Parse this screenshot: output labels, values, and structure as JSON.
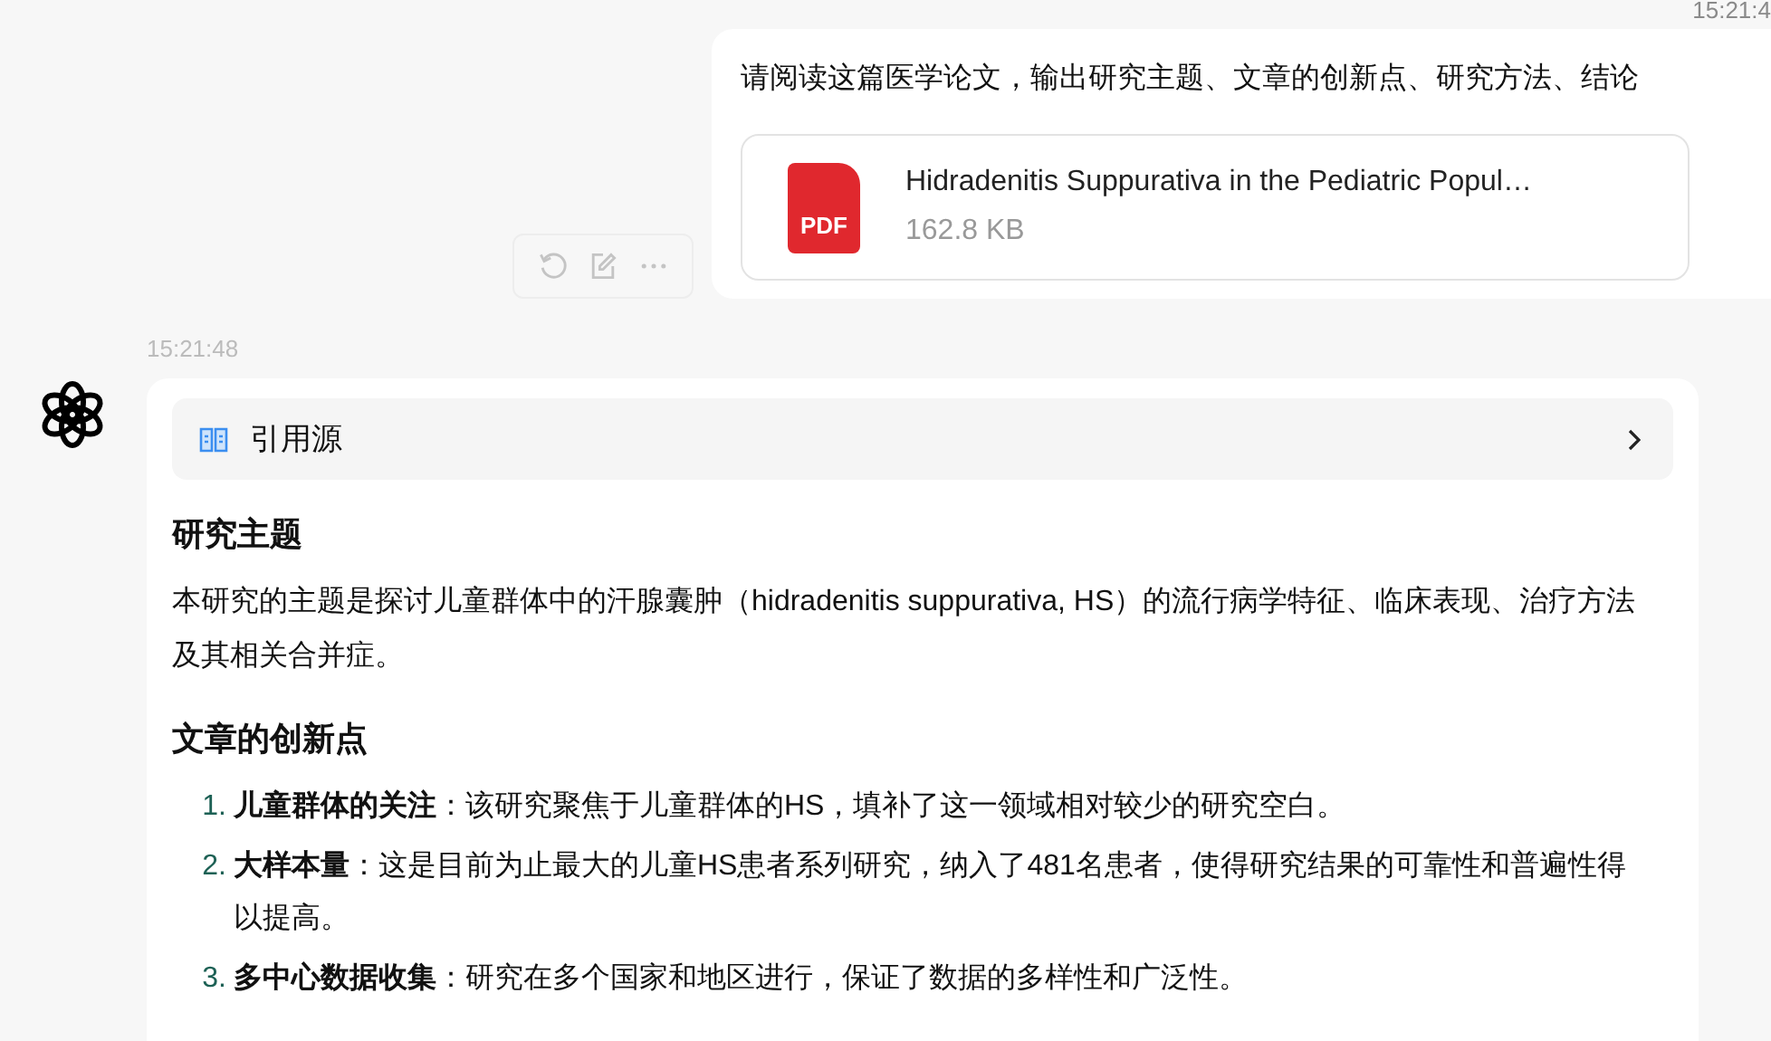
{
  "top_timestamp": "15:21:4",
  "user_message": {
    "text": "请阅读这篇医学论文，输出研究主题、文章的创新点、研究方法、结论",
    "attachment": {
      "file_type": "PDF",
      "name": "Hidradenitis Suppurativa in the Pediatric Popul…",
      "size": "162.8 KB"
    }
  },
  "assistant_message": {
    "timestamp": "15:21:48",
    "sources": {
      "label": "引用源"
    },
    "sections": [
      {
        "heading": "研究主题",
        "paragraphs": [
          "本研究的主题是探讨儿童群体中的汗腺囊肿（hidradenitis suppurativa, HS）的流行病学特征、临床表现、治疗方法及其相关合并症。"
        ]
      },
      {
        "heading": "文章的创新点",
        "list": [
          {
            "number": "1.",
            "text": "**儿童群体的关注**：该研究聚焦于儿童群体的HS，填补了这一领域相对较少的研究空白。"
          },
          {
            "number": "2.",
            "text": "**大样本量**：这是目前为止最大的儿童HS患者系列研究，纳入了481名患者，使得研究结果的可靠性和普遍性得以提高。"
          },
          {
            "number": "3.",
            "text": "**多中心数据收集**：研究在多个国家和地区进行，保证了数据的多样性和广泛性。"
          }
        ]
      }
    ]
  }
}
